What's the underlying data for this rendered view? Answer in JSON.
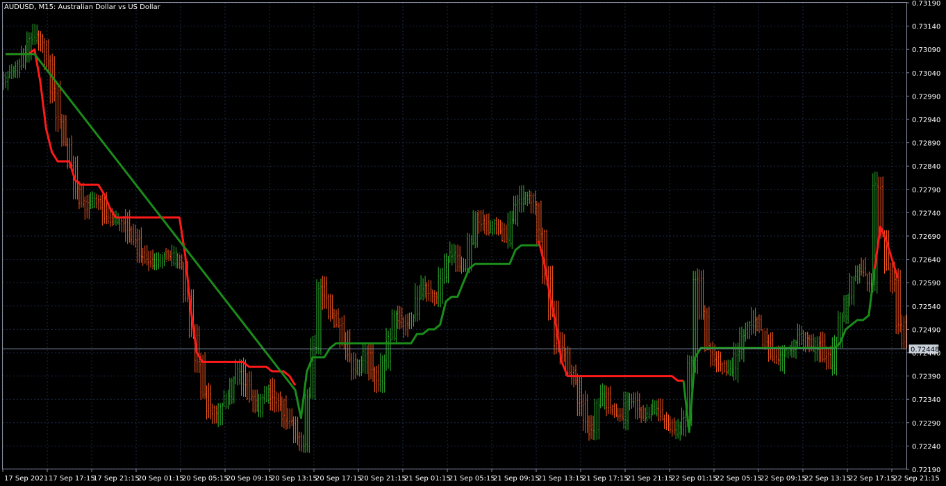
{
  "window": {
    "title": "AUDUSD, M15:  Australian Dollar vs US Dollar"
  },
  "colors": {
    "background": "#000000",
    "grid": "#1c2a4a",
    "frame": "#8a8fa0",
    "bull_candle": "#2eb82e",
    "bear_candle": "#ff5a1e",
    "up_line": "#1a8c1a",
    "down_line": "#ff1a1a",
    "current_price_line": "#7f8fa8",
    "text": "#ffffff"
  },
  "current_price": {
    "value": 0.72448,
    "label": "0.72448"
  },
  "chart_data": {
    "type": "line",
    "symbol": "AUDUSD",
    "timeframe": "M15",
    "title": "AUDUSD, M15:  Australian Dollar vs US Dollar",
    "ylim": [
      0.7219,
      0.7319
    ],
    "y_ticks": [
      0.7219,
      0.7224,
      0.7229,
      0.7234,
      0.7239,
      0.7244,
      0.7249,
      0.7254,
      0.7259,
      0.7264,
      0.7269,
      0.7274,
      0.7279,
      0.7284,
      0.7289,
      0.7294,
      0.7299,
      0.7304,
      0.7309,
      0.7314,
      0.7319
    ],
    "y_tick_labels": [
      "0.72190",
      "0.72240",
      "0.72290",
      "0.72340",
      "0.72390",
      "0.72440",
      "0.72490",
      "0.72540",
      "0.72590",
      "0.72640",
      "0.72690",
      "0.72740",
      "0.72790",
      "0.72840",
      "0.72890",
      "0.72940",
      "0.72990",
      "0.73040",
      "0.73090",
      "0.73140",
      "0.73190"
    ],
    "x_tick_labels": [
      "17 Sep 2021",
      "17 Sep 17:15",
      "17 Sep 21:15",
      "20 Sep 01:15",
      "20 Sep 05:15",
      "20 Sep 09:15",
      "20 Sep 13:15",
      "20 Sep 17:15",
      "20 Sep 21:15",
      "21 Sep 01:15",
      "21 Sep 05:15",
      "21 Sep 09:15",
      "21 Sep 13:15",
      "21 Sep 17:15",
      "21 Sep 21:15",
      "22 Sep 01:15",
      "22 Sep 05:15",
      "22 Sep 09:15",
      "22 Sep 13:15",
      "22 Sep 17:15",
      "22 Sep 21:15"
    ],
    "grid": true,
    "close_series": [
      [
        0,
        0.7303
      ],
      [
        1,
        0.7304
      ],
      [
        2,
        0.7306
      ],
      [
        3,
        0.7308
      ],
      [
        4,
        0.7311
      ],
      [
        5,
        0.7312
      ],
      [
        6,
        0.73105
      ],
      [
        7,
        0.7306
      ],
      [
        8,
        0.73
      ],
      [
        9,
        0.7294
      ],
      [
        10,
        0.7289
      ],
      [
        11,
        0.7284
      ],
      [
        12,
        0.7279
      ],
      [
        13,
        0.7276
      ],
      [
        14,
        0.7275
      ],
      [
        15,
        0.7277
      ],
      [
        16,
        0.7276
      ],
      [
        17,
        0.7273
      ],
      [
        18,
        0.7272
      ],
      [
        19,
        0.7273
      ],
      [
        20,
        0.7272
      ],
      [
        21,
        0.727
      ],
      [
        22,
        0.7268
      ],
      [
        23,
        0.7265
      ],
      [
        24,
        0.7264
      ],
      [
        25,
        0.7263
      ],
      [
        26,
        0.7264
      ],
      [
        27,
        0.7265
      ],
      [
        28,
        0.7264
      ],
      [
        29,
        0.7265
      ],
      [
        30,
        0.7263
      ],
      [
        31,
        0.7256
      ],
      [
        32,
        0.7248
      ],
      [
        33,
        0.7242
      ],
      [
        34,
        0.7235
      ],
      [
        35,
        0.7232
      ],
      [
        36,
        0.7231
      ],
      [
        37,
        0.7233
      ],
      [
        38,
        0.7235
      ],
      [
        39,
        0.7238
      ],
      [
        40,
        0.724
      ],
      [
        41,
        0.7237
      ],
      [
        42,
        0.7234
      ],
      [
        43,
        0.7232
      ],
      [
        44,
        0.7234
      ],
      [
        45,
        0.7236
      ],
      [
        46,
        0.7234
      ],
      [
        47,
        0.7233
      ],
      [
        48,
        0.723
      ],
      [
        49,
        0.7229
      ],
      [
        50,
        0.7226
      ],
      [
        51,
        0.7224
      ],
      [
        52,
        0.7235
      ],
      [
        53,
        0.7245
      ],
      [
        54,
        0.7258
      ],
      [
        55,
        0.7256
      ],
      [
        56,
        0.7252
      ],
      [
        57,
        0.725
      ],
      [
        58,
        0.7246
      ],
      [
        59,
        0.7243
      ],
      [
        60,
        0.724
      ],
      [
        61,
        0.7242
      ],
      [
        62,
        0.7244
      ],
      [
        63,
        0.724
      ],
      [
        64,
        0.7238
      ],
      [
        65,
        0.7242
      ],
      [
        66,
        0.7247
      ],
      [
        67,
        0.7252
      ],
      [
        68,
        0.7251
      ],
      [
        69,
        0.725
      ],
      [
        70,
        0.7252
      ],
      [
        71,
        0.7256
      ],
      [
        72,
        0.7258
      ],
      [
        73,
        0.7257
      ],
      [
        74,
        0.7256
      ],
      [
        75,
        0.726
      ],
      [
        76,
        0.7264
      ],
      [
        77,
        0.7265
      ],
      [
        78,
        0.7262
      ],
      [
        79,
        0.7262
      ],
      [
        80,
        0.7268
      ],
      [
        81,
        0.7274
      ],
      [
        82,
        0.7272
      ],
      [
        83,
        0.727
      ],
      [
        84,
        0.7272
      ],
      [
        85,
        0.727
      ],
      [
        86,
        0.7268
      ],
      [
        87,
        0.7272
      ],
      [
        88,
        0.7276
      ],
      [
        89,
        0.7277
      ],
      [
        90,
        0.7278
      ],
      [
        91,
        0.7276
      ],
      [
        92,
        0.727
      ],
      [
        93,
        0.726
      ],
      [
        94,
        0.7252
      ],
      [
        95,
        0.7246
      ],
      [
        96,
        0.7244
      ],
      [
        97,
        0.724
      ],
      [
        98,
        0.7238
      ],
      [
        99,
        0.7233
      ],
      [
        100,
        0.7229
      ],
      [
        101,
        0.7227
      ],
      [
        102,
        0.7233
      ],
      [
        103,
        0.7235
      ],
      [
        104,
        0.7232
      ],
      [
        105,
        0.7231
      ],
      [
        106,
        0.723
      ],
      [
        107,
        0.7233
      ],
      [
        108,
        0.7234
      ],
      [
        109,
        0.7232
      ],
      [
        110,
        0.723
      ],
      [
        111,
        0.7231
      ],
      [
        112,
        0.7232
      ],
      [
        113,
        0.723
      ],
      [
        114,
        0.7229
      ],
      [
        115,
        0.7227
      ],
      [
        116,
        0.7228
      ],
      [
        117,
        0.723
      ],
      [
        118,
        0.7242
      ],
      [
        119,
        0.726
      ],
      [
        120,
        0.7252
      ],
      [
        121,
        0.7245
      ],
      [
        122,
        0.7243
      ],
      [
        123,
        0.7242
      ],
      [
        124,
        0.724
      ],
      [
        125,
        0.724
      ],
      [
        126,
        0.7244
      ],
      [
        127,
        0.7248
      ],
      [
        128,
        0.725
      ],
      [
        129,
        0.7251
      ],
      [
        130,
        0.7249
      ],
      [
        131,
        0.7246
      ],
      [
        132,
        0.7243
      ],
      [
        133,
        0.7242
      ],
      [
        134,
        0.7244
      ],
      [
        135,
        0.7245
      ],
      [
        136,
        0.7246
      ],
      [
        137,
        0.7248
      ],
      [
        138,
        0.7247
      ],
      [
        139,
        0.7245
      ],
      [
        140,
        0.7246
      ],
      [
        141,
        0.7243
      ],
      [
        142,
        0.7241
      ],
      [
        143,
        0.7247
      ],
      [
        144,
        0.7252
      ],
      [
        145,
        0.7256
      ],
      [
        146,
        0.726
      ],
      [
        147,
        0.7262
      ],
      [
        148,
        0.7261
      ],
      [
        149,
        0.7259
      ],
      [
        150,
        0.728
      ],
      [
        151,
        0.7269
      ],
      [
        152,
        0.7262
      ],
      [
        153,
        0.7259
      ],
      [
        154,
        0.725
      ],
      [
        155,
        0.7246
      ]
    ],
    "series": [
      {
        "name": "",
        "color": "#ff1a1a",
        "points": [
          [
            0,
            0.7308
          ],
          [
            3,
            0.7308
          ],
          [
            4,
            0.7308
          ],
          [
            5,
            0.7309
          ],
          [
            6,
            0.7302
          ],
          [
            7,
            0.7292
          ],
          [
            8,
            0.7287
          ],
          [
            9,
            0.7285
          ],
          [
            10,
            0.7285
          ],
          [
            11,
            0.7285
          ],
          [
            12,
            0.7281
          ],
          [
            13,
            0.728
          ],
          [
            14,
            0.728
          ],
          [
            15,
            0.728
          ],
          [
            16,
            0.728
          ],
          [
            17,
            0.7278
          ],
          [
            18,
            0.7275
          ],
          [
            19,
            0.7273
          ],
          [
            20,
            0.7273
          ],
          [
            21,
            0.7273
          ],
          [
            22,
            0.7273
          ],
          [
            23,
            0.7273
          ],
          [
            24,
            0.7273
          ],
          [
            25,
            0.7273
          ],
          [
            26,
            0.7273
          ],
          [
            27,
            0.7273
          ],
          [
            28,
            0.7273
          ],
          [
            29,
            0.7273
          ],
          [
            30,
            0.7273
          ],
          [
            31,
            0.7265
          ],
          [
            32,
            0.7253
          ],
          [
            33,
            0.7244
          ],
          [
            34,
            0.7242
          ],
          [
            35,
            0.7242
          ],
          [
            36,
            0.7242
          ],
          [
            37,
            0.7242
          ],
          [
            38,
            0.7242
          ],
          [
            39,
            0.7242
          ],
          [
            40,
            0.7242
          ],
          [
            41,
            0.7242
          ],
          [
            42,
            0.7241
          ],
          [
            43,
            0.7241
          ],
          [
            44,
            0.7241
          ],
          [
            45,
            0.7241
          ],
          [
            46,
            0.724
          ],
          [
            47,
            0.724
          ],
          [
            48,
            0.724
          ],
          [
            49,
            0.7239
          ],
          [
            50,
            0.7237
          ]
        ]
      },
      {
        "name": "",
        "color": "#1a8c1a",
        "points": [
          [
            0,
            0.7308
          ],
          [
            3,
            0.7308
          ],
          [
            4,
            0.7308
          ],
          [
            5,
            0.7308
          ],
          [
            50,
            0.7236
          ],
          [
            51,
            0.723
          ],
          [
            52,
            0.724
          ],
          [
            53,
            0.7243
          ],
          [
            54,
            0.7243
          ],
          [
            55,
            0.7243
          ],
          [
            56,
            0.7245
          ],
          [
            57,
            0.7246
          ],
          [
            58,
            0.7246
          ],
          [
            59,
            0.7246
          ],
          [
            60,
            0.7246
          ],
          [
            61,
            0.7246
          ],
          [
            62,
            0.7246
          ],
          [
            63,
            0.7246
          ],
          [
            64,
            0.7246
          ],
          [
            65,
            0.7246
          ],
          [
            66,
            0.7246
          ],
          [
            67,
            0.7246
          ],
          [
            68,
            0.7246
          ],
          [
            69,
            0.7246
          ],
          [
            70,
            0.7246
          ],
          [
            71,
            0.7248
          ],
          [
            72,
            0.7248
          ],
          [
            73,
            0.7249
          ],
          [
            74,
            0.7249
          ],
          [
            75,
            0.725
          ],
          [
            76,
            0.7255
          ],
          [
            77,
            0.7256
          ],
          [
            78,
            0.7256
          ],
          [
            79,
            0.7259
          ],
          [
            80,
            0.7262
          ],
          [
            81,
            0.7263
          ],
          [
            82,
            0.7263
          ],
          [
            83,
            0.7263
          ],
          [
            84,
            0.7263
          ],
          [
            85,
            0.7263
          ],
          [
            86,
            0.7263
          ],
          [
            87,
            0.7263
          ],
          [
            88,
            0.7266
          ],
          [
            89,
            0.7267
          ],
          [
            90,
            0.7267
          ],
          [
            91,
            0.7267
          ],
          [
            92,
            0.7267
          ]
        ]
      },
      {
        "name": "",
        "color": "#ff1a1a",
        "points": [
          [
            92,
            0.7268
          ],
          [
            93,
            0.7263
          ],
          [
            94,
            0.7256
          ],
          [
            95,
            0.725
          ],
          [
            96,
            0.7242
          ],
          [
            97,
            0.7239
          ],
          [
            98,
            0.7239
          ],
          [
            99,
            0.7239
          ],
          [
            100,
            0.7239
          ],
          [
            101,
            0.7239
          ],
          [
            102,
            0.7239
          ],
          [
            103,
            0.7239
          ],
          [
            104,
            0.7239
          ],
          [
            105,
            0.7239
          ],
          [
            106,
            0.7239
          ],
          [
            107,
            0.7239
          ],
          [
            108,
            0.7239
          ],
          [
            109,
            0.7239
          ],
          [
            110,
            0.7239
          ],
          [
            111,
            0.7239
          ],
          [
            112,
            0.7239
          ],
          [
            113,
            0.7239
          ],
          [
            114,
            0.7239
          ],
          [
            115,
            0.7239
          ],
          [
            116,
            0.7238
          ],
          [
            117,
            0.7238
          ]
        ]
      },
      {
        "name": "",
        "color": "#1a8c1a",
        "points": [
          [
            117,
            0.7238
          ],
          [
            118,
            0.7227
          ],
          [
            119,
            0.7243
          ],
          [
            120,
            0.7245
          ],
          [
            121,
            0.7245
          ],
          [
            122,
            0.7245
          ],
          [
            123,
            0.7245
          ],
          [
            124,
            0.7245
          ],
          [
            125,
            0.7245
          ],
          [
            126,
            0.7245
          ],
          [
            127,
            0.7245
          ],
          [
            128,
            0.7245
          ],
          [
            129,
            0.7245
          ],
          [
            130,
            0.7245
          ],
          [
            131,
            0.7245
          ],
          [
            132,
            0.7245
          ],
          [
            133,
            0.7245
          ],
          [
            134,
            0.7245
          ],
          [
            135,
            0.7245
          ],
          [
            136,
            0.7245
          ],
          [
            137,
            0.7245
          ],
          [
            138,
            0.7245
          ],
          [
            139,
            0.7245
          ],
          [
            140,
            0.7245
          ],
          [
            141,
            0.7245
          ],
          [
            142,
            0.7245
          ],
          [
            143,
            0.7245
          ],
          [
            144,
            0.7246
          ],
          [
            145,
            0.7249
          ],
          [
            146,
            0.725
          ],
          [
            147,
            0.7251
          ],
          [
            148,
            0.7251
          ],
          [
            149,
            0.7252
          ],
          [
            150,
            0.7262
          ]
        ]
      },
      {
        "name": "",
        "color": "#ff1a1a",
        "points": [
          [
            150,
            0.7262
          ],
          [
            151,
            0.7271
          ],
          [
            152,
            0.7268
          ],
          [
            153,
            0.7264
          ],
          [
            154,
            0.726
          ]
        ]
      }
    ]
  }
}
